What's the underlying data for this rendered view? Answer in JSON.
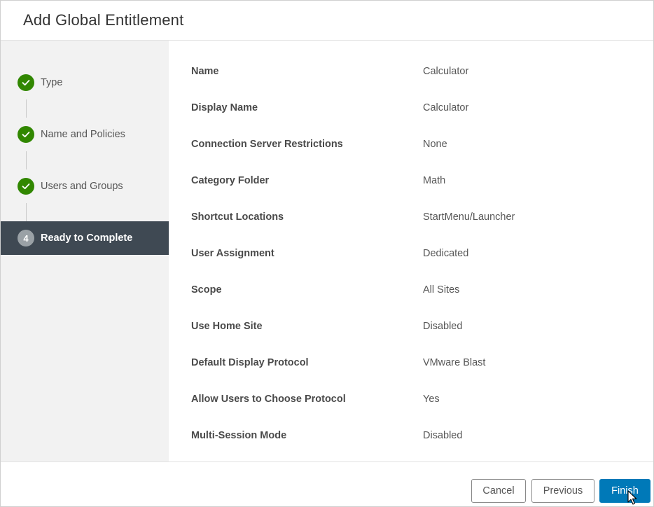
{
  "dialog": {
    "title": "Add Global Entitlement"
  },
  "steps": [
    {
      "label": "Type",
      "status": "complete",
      "icon": "check-icon"
    },
    {
      "label": "Name and Policies",
      "status": "complete",
      "icon": "check-icon"
    },
    {
      "label": "Users and Groups",
      "status": "complete",
      "icon": "check-icon"
    },
    {
      "label": "Ready to Complete",
      "status": "active",
      "number": "4"
    }
  ],
  "summary": [
    {
      "label": "Name",
      "value": "Calculator"
    },
    {
      "label": "Display Name",
      "value": "Calculator"
    },
    {
      "label": "Connection Server Restrictions",
      "value": "None"
    },
    {
      "label": "Category Folder",
      "value": "Math"
    },
    {
      "label": "Shortcut Locations",
      "value": "StartMenu/Launcher"
    },
    {
      "label": "User Assignment",
      "value": "Dedicated"
    },
    {
      "label": "Scope",
      "value": "All Sites"
    },
    {
      "label": "Use Home Site",
      "value": "Disabled"
    },
    {
      "label": "Default Display Protocol",
      "value": "VMware Blast"
    },
    {
      "label": "Allow Users to Choose Protocol",
      "value": "Yes"
    },
    {
      "label": "Multi-Session Mode",
      "value": "Disabled"
    }
  ],
  "footer": {
    "cancel_label": "Cancel",
    "previous_label": "Previous",
    "finish_label": "Finish"
  },
  "colors": {
    "complete": "#318700",
    "active_bg": "#3f4953",
    "primary": "#0079b8"
  }
}
